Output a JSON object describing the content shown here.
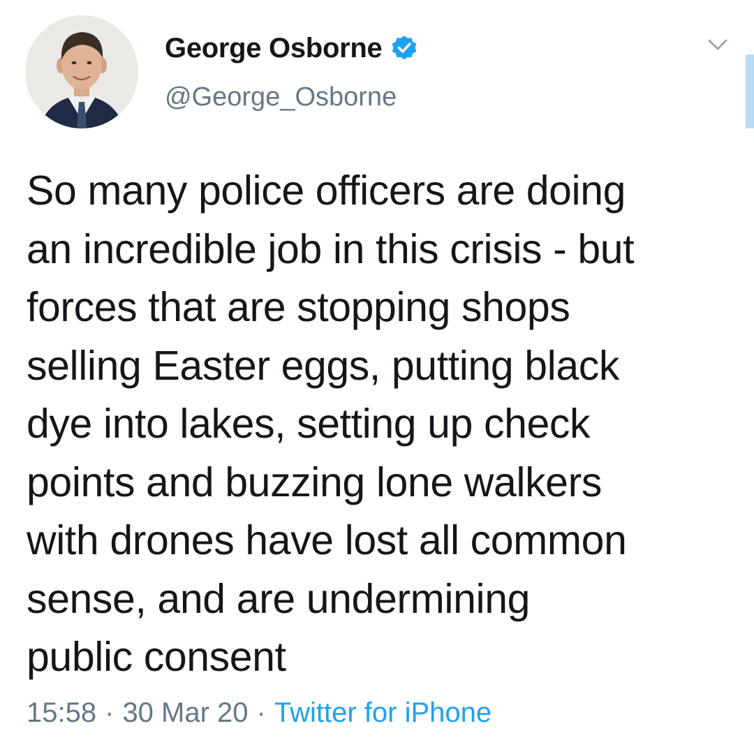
{
  "user": {
    "display_name": "George Osborne",
    "handle": "@George_Osborne",
    "verified": true,
    "avatar_icon": "profile-photo"
  },
  "tweet": {
    "lines": [
      "So many police officers are doing",
      "an incredible job in this crisis - but",
      "forces that are stopping shops",
      "selling Easter eggs, putting black",
      "dye into lakes, setting up check",
      "points and buzzing lone walkers",
      "with drones have lost all common",
      "sense, and are undermining",
      "public consent"
    ]
  },
  "meta": {
    "time": "15:58",
    "separator": "·",
    "date": "30 Mar 20",
    "source": "Twitter for iPhone"
  },
  "colors": {
    "text": "#14171a",
    "secondary": "#657786",
    "link": "#1da1f2",
    "verified_badge": "#1da1f2"
  },
  "icons": {
    "menu": "chevron-down-icon",
    "verified": "verified-badge-icon"
  }
}
